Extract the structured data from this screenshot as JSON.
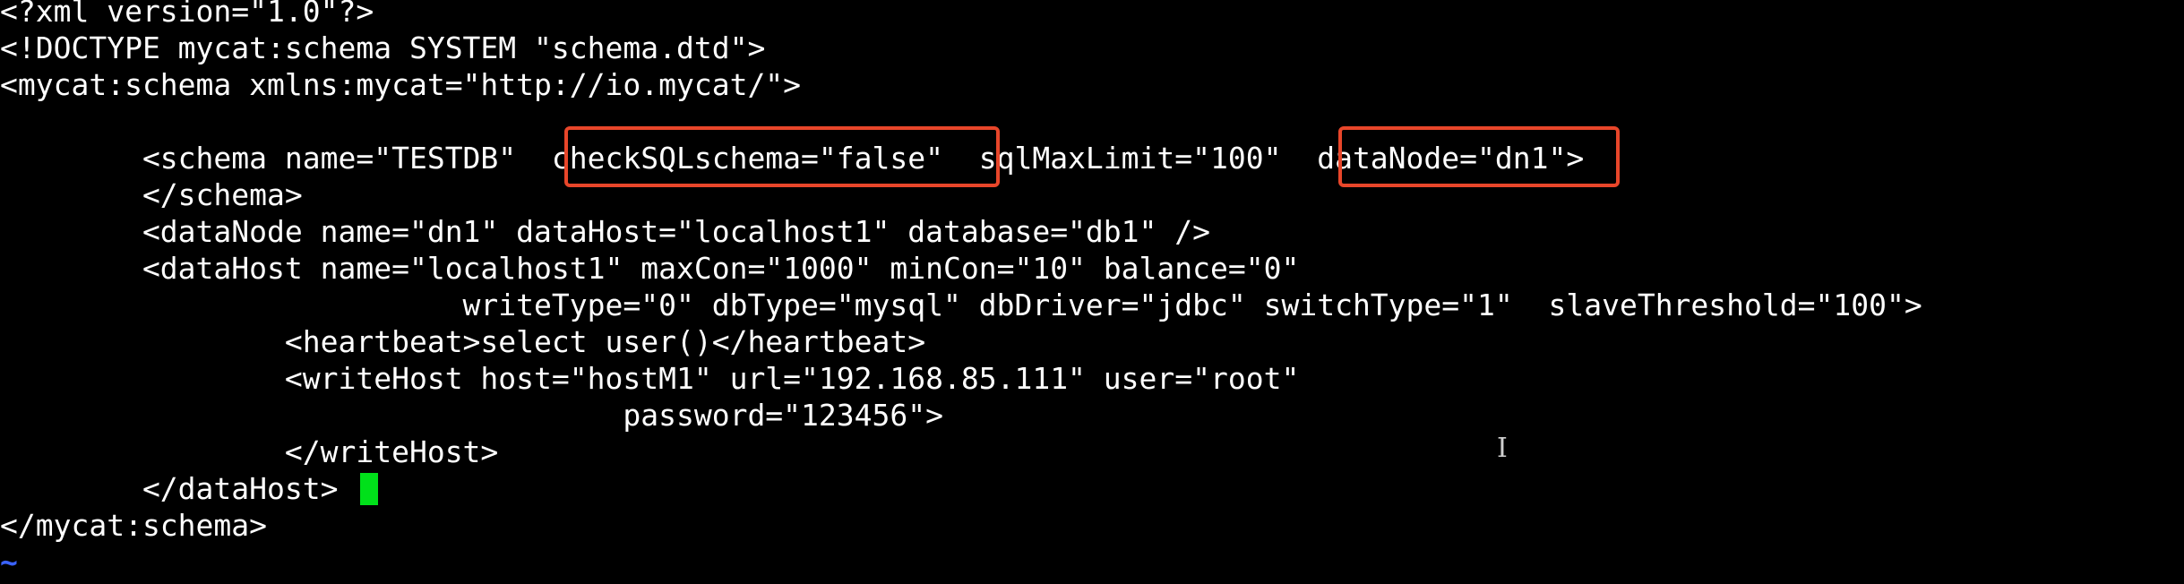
{
  "editor": {
    "lines": [
      "<?xml version=\"1.0\"?>",
      "<!DOCTYPE mycat:schema SYSTEM \"schema.dtd\">",
      "<mycat:schema xmlns:mycat=\"http://io.mycat/\">",
      "",
      "        <schema name=\"TESTDB\"  checkSQLschema=\"false\"  sqlMaxLimit=\"100\"  dataNode=\"dn1\">",
      "        </schema>",
      "        <dataNode name=\"dn1\" dataHost=\"localhost1\" database=\"db1\" />",
      "        <dataHost name=\"localhost1\" maxCon=\"1000\" minCon=\"10\" balance=\"0\"",
      "                          writeType=\"0\" dbType=\"mysql\" dbDriver=\"jdbc\" switchType=\"1\"  slaveThreshold=\"100\">",
      "                <heartbeat>select user()</heartbeat>",
      "                <writeHost host=\"hostM1\" url=\"192.168.85.111\" user=\"root\"",
      "                                   password=\"123456\">",
      "                </writeHost>",
      "        </dataHost>",
      "</mycat:schema>"
    ],
    "empty_line_marker": "~",
    "mouse_cursor_glyph": "I",
    "annotations": [
      "checkSQLschema=\"false\"",
      "dataNode=\"dn1\""
    ]
  },
  "colors": {
    "background": "#000000",
    "text": "#ffffff",
    "annotation_box": "#e8462a",
    "cursor": "#00e01a",
    "tilde": "#3a62ff"
  }
}
